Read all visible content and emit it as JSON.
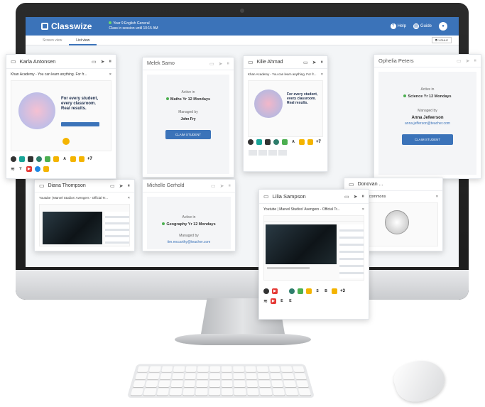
{
  "app": {
    "name": "Classwize",
    "class_title": "Year 9 English General",
    "class_subtitle": "Class in session until 10:15 AM",
    "help_label": "Help",
    "guide_label": "Guide",
    "tabs": [
      {
        "label": "Screen view"
      },
      {
        "label": "List view"
      }
    ],
    "rule_button": "1 RULE"
  },
  "cards": {
    "karla": {
      "name": "Karla Antonsen",
      "site": "Khan Academy - You can learn anything. For fr...",
      "hero": "For every student, every classroom. Real results.",
      "more": "+7"
    },
    "melek": {
      "name": "Melek Samo",
      "active_in": "Active in",
      "class": "Maths Yr 12 Mondays",
      "managed_by": "Managed by",
      "manager": "John Fry"
    },
    "kilie": {
      "name": "Kilie Ahmad",
      "site": "Khan Academy - You can learn anything. For fr...",
      "hero": "For every student, every classroom. Real results.",
      "more": "+7"
    },
    "ophelia": {
      "name": "Ophelia Peters",
      "active_in": "Active in",
      "class": "Science Yr 12 Mondays",
      "managed_by": "Managed by",
      "manager": "Anna Jefeerson",
      "email": "anna.jefferson@teacher.com",
      "claim": "CLAIM STUDENT"
    },
    "diana": {
      "name": "Diana Thompson",
      "site": "Youtube | Marvel Studios' Avengers - Official Tr..."
    },
    "michelle": {
      "name": "Michelle Gerhold",
      "active_in": "Active in",
      "class": "Geography Yr 12 Mondays",
      "managed_by": "Managed by",
      "email": "tim.mccarthy@teacher.com"
    },
    "donovan": {
      "name": "Donovan ...",
      "site": "...commons"
    },
    "lilia": {
      "name": "Lilia Sampson",
      "site": "Youtube | Marvel Studios' Avengers - Official Tr...",
      "more": "+3"
    },
    "claim_label": "CLAIM STUDENT"
  },
  "colors": {
    "brand_blue": "#3b73b9",
    "active_green": "#4caf50"
  }
}
